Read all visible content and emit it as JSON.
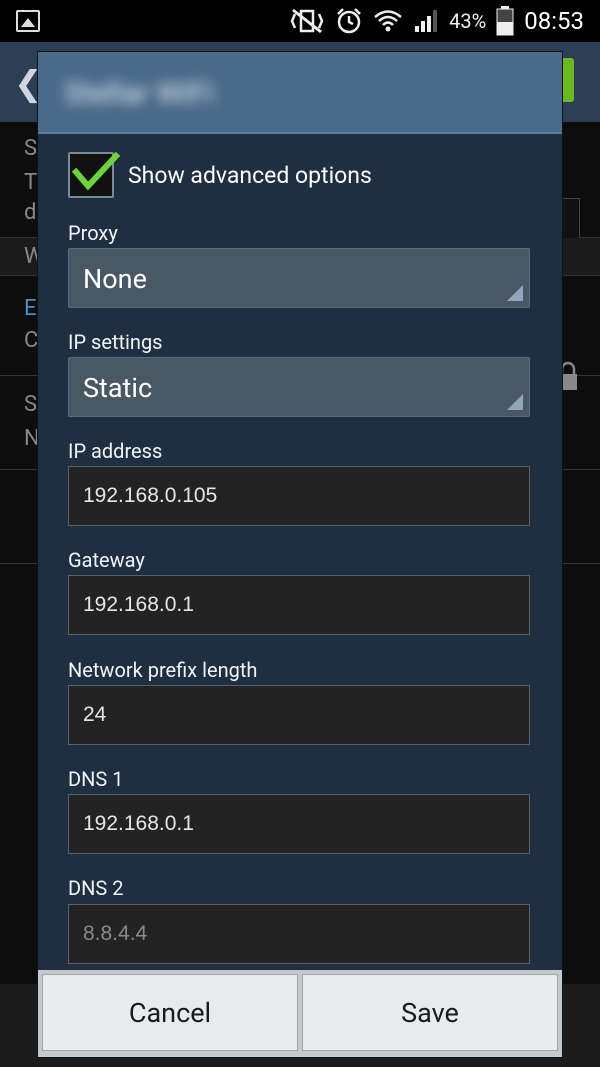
{
  "status_bar": {
    "battery_percent": "43%",
    "time": "08:53",
    "icons": [
      "image-icon",
      "vibrate-mute-icon",
      "alarm-icon",
      "wifi-icon",
      "signal-icon",
      "battery-icon"
    ]
  },
  "background": {
    "row_chars": [
      "S",
      "T",
      "d",
      "W",
      "E",
      "C",
      "S",
      "N"
    ]
  },
  "dialog": {
    "title": "Stellar WiFi",
    "show_advanced_label": "Show advanced options",
    "show_advanced_checked": true,
    "proxy": {
      "label": "Proxy",
      "value": "None"
    },
    "ip_settings": {
      "label": "IP settings",
      "value": "Static"
    },
    "ip_address": {
      "label": "IP address",
      "value": "192.168.0.105"
    },
    "gateway": {
      "label": "Gateway",
      "value": "192.168.0.1"
    },
    "prefix_length": {
      "label": "Network prefix length",
      "value": "24"
    },
    "dns1": {
      "label": "DNS 1",
      "value": "192.168.0.1"
    },
    "dns2": {
      "label": "DNS 2",
      "placeholder": "8.8.4.4"
    },
    "cancel_label": "Cancel",
    "save_label": "Save"
  },
  "colors": {
    "dialog_bg": "#1f2f41",
    "header_bg": "#4a6a8a",
    "check_green": "#6bd33b"
  }
}
